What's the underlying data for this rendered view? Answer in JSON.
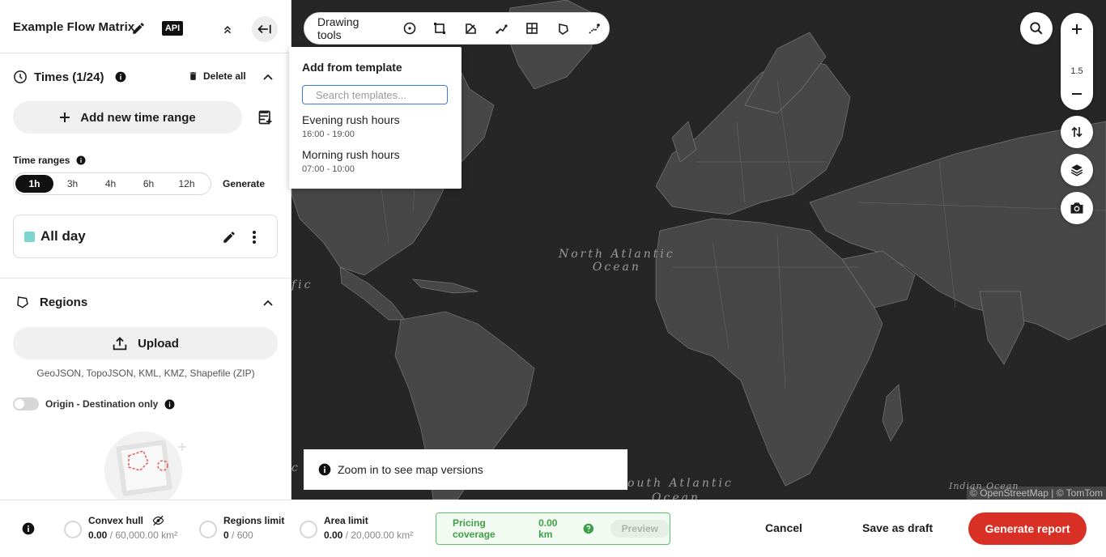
{
  "app": {
    "title": "Example Flow Matrix",
    "api_badge": "API"
  },
  "times": {
    "header": "Times (1/24)",
    "delete_all": "Delete all",
    "add_range": "Add new time range",
    "ranges_label": "Time ranges",
    "ranges": [
      "1h",
      "3h",
      "4h",
      "6h",
      "12h"
    ],
    "active_range": "1h",
    "generate": "Generate",
    "all_day": "All day",
    "all_day_color": "#7fd3d0"
  },
  "regions": {
    "header": "Regions",
    "upload": "Upload",
    "formats": "GeoJSON, TopoJSON, KML, KMZ, Shapefile (ZIP)",
    "od_only": "Origin - Destination only"
  },
  "toolbar": {
    "label": "Drawing tools"
  },
  "template_popup": {
    "title": "Add from template",
    "search_placeholder": "Search templates...",
    "items": [
      {
        "name": "Evening rush hours",
        "time": "16:00 - 19:00"
      },
      {
        "name": "Morning rush hours",
        "time": "07:00 - 10:00"
      }
    ]
  },
  "map": {
    "ocean_north_1": "North Atlantic",
    "ocean_north_2": "Ocean",
    "ocean_south": "outh Atlantic",
    "ocean_south_2": "Ocean",
    "pacific_fragment": "fic",
    "pacific_fragment_2": "c",
    "indian": "Indian Ocean",
    "zoom_level": "1.5",
    "attribution": "© OpenStreetMap | © TomTom",
    "toast": "Zoom in to see map versions"
  },
  "bottom": {
    "convex_hull": {
      "title": "Convex hull",
      "value": "0.00",
      "limit": "60,000.00 km²"
    },
    "regions_limit": {
      "title": "Regions limit",
      "value": "0",
      "limit": "600"
    },
    "area_limit": {
      "title": "Area limit",
      "value": "0.00",
      "limit": "20,000.00 km²"
    },
    "coverage_label": "Pricing coverage",
    "coverage_value": "0.00 km",
    "preview": "Preview",
    "cancel": "Cancel",
    "save_draft": "Save as draft",
    "generate_report": "Generate report"
  },
  "colors": {
    "accent": "#d93025",
    "coverage_green": "#3f9f48",
    "map_bg": "#262626",
    "land": "#474747"
  }
}
